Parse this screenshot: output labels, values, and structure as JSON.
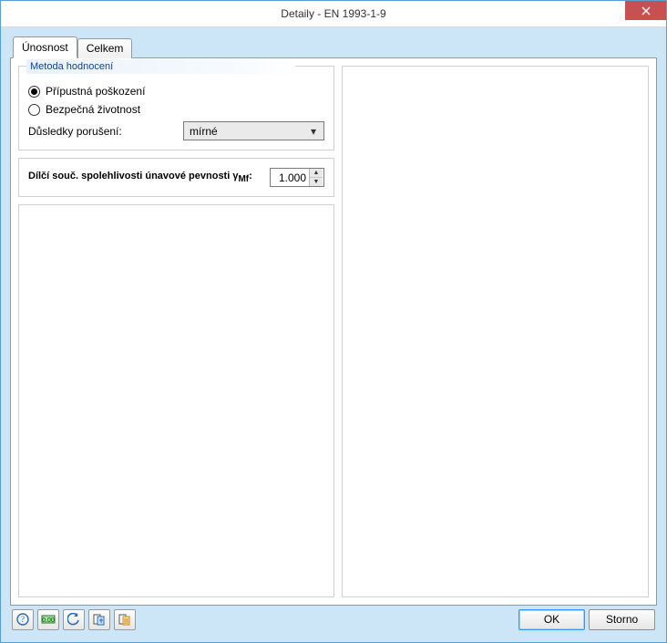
{
  "window": {
    "title": "Detaily - EN 1993-1-9",
    "close_icon": "close"
  },
  "tabs": [
    {
      "label": "Únosnost",
      "active": true
    },
    {
      "label": "Celkem",
      "active": false
    }
  ],
  "assess": {
    "legend": "Metoda hodnocení",
    "radio1": {
      "label": "Přípustná poškození",
      "checked": true
    },
    "radio2": {
      "label": "Bezpečná životnost",
      "checked": false
    },
    "consequence_label": "Důsledky porušení:",
    "consequence_value": "mírné"
  },
  "factor": {
    "label_main": "Dílčí souč. spolehlivosti únavové pevnosti ",
    "label_sym": "γ",
    "label_sub": "Mf",
    "label_colon": ":",
    "value": "1.000"
  },
  "toolbar_icons": [
    "help-icon",
    "units-icon",
    "undo-icon",
    "copy-props-icon",
    "paste-props-icon"
  ],
  "buttons": {
    "ok": "OK",
    "cancel": "Storno"
  }
}
